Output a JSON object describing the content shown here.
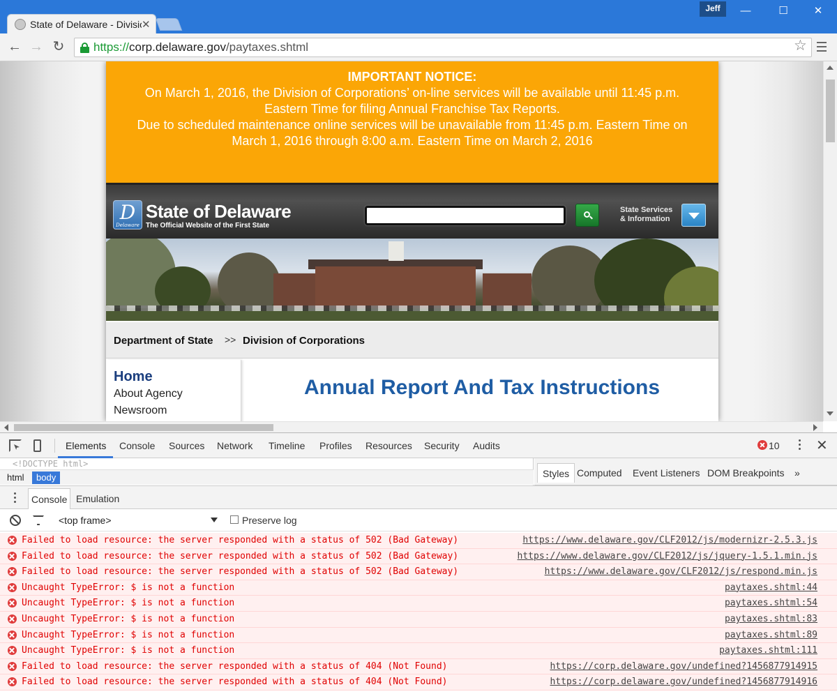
{
  "browser": {
    "tab_title": "State of Delaware - Divisio",
    "user": "Jeff",
    "url_scheme": "https://",
    "url_host": "corp.delaware.gov",
    "url_path": "/paytaxes.shtml",
    "minimize": "—",
    "maximize": "☐",
    "close": "✕"
  },
  "page": {
    "notice": {
      "title": "IMPORTANT NOTICE:",
      "line1": "On March 1, 2016, the Division of Corporations’ on-line services will be available until 11:45 p.m.",
      "line2": "Eastern Time for filing Annual Franchise Tax Reports.",
      "line3": "Due to scheduled maintenance online services will be unavailable from 11:45 p.m. Eastern Time on",
      "line4": "March 1, 2016 through 8:00 a.m. Eastern Time on March 2, 2016"
    },
    "header": {
      "seal_letter": "D",
      "seal_text": "Delaware",
      "title": "State of Delaware",
      "subtitle": "The Official Website of the First State",
      "services_line1": "State Services",
      "services_line2": "& Information"
    },
    "breadcrumb": {
      "first": "Department of State",
      "separator": ">>",
      "second": "Division of Corporations"
    },
    "sidenav": {
      "home": "Home",
      "about": "About Agency",
      "newsroom": "Newsroom"
    },
    "content_title": "Annual Report And Tax Instructions"
  },
  "devtools": {
    "tabs": [
      "Elements",
      "Console",
      "Sources",
      "Network",
      "Timeline",
      "Profiles",
      "Resources",
      "Security",
      "Audits"
    ],
    "error_count": "10",
    "doctype": "<!DOCTYPE html>",
    "dom_crumbs": [
      "html",
      "body"
    ],
    "sidebar_tabs": [
      "Styles",
      "Computed",
      "Event Listeners",
      "DOM Breakpoints",
      "»"
    ],
    "drawer_tabs": [
      "Console",
      "Emulation"
    ],
    "frame": "<top frame>",
    "preserve_log": "Preserve log",
    "messages": [
      {
        "text": "Failed to load resource: the server responded with a status of 502 (Bad Gateway)",
        "source": "https://www.delaware.gov/CLF2012/js/modernizr-2.5.3.js"
      },
      {
        "text": "Failed to load resource: the server responded with a status of 502 (Bad Gateway)",
        "source": "https://www.delaware.gov/CLF2012/js/jquery-1.5.1.min.js"
      },
      {
        "text": "Failed to load resource: the server responded with a status of 502 (Bad Gateway)",
        "source": "https://www.delaware.gov/CLF2012/js/respond.min.js"
      },
      {
        "text": "Uncaught TypeError: $ is not a function",
        "source": "paytaxes.shtml:44"
      },
      {
        "text": "Uncaught TypeError: $ is not a function",
        "source": "paytaxes.shtml:54"
      },
      {
        "text": "Uncaught TypeError: $ is not a function",
        "source": "paytaxes.shtml:83"
      },
      {
        "text": "Uncaught TypeError: $ is not a function",
        "source": "paytaxes.shtml:89"
      },
      {
        "text": "Uncaught TypeError: $ is not a function",
        "source": "paytaxes.shtml:111"
      },
      {
        "text": "Failed to load resource: the server responded with a status of 404 (Not Found)",
        "source": "https://corp.delaware.gov/undefined?1456877914915"
      },
      {
        "text": "Failed to load resource: the server responded with a status of 404 (Not Found)",
        "source": "https://corp.delaware.gov/undefined?1456877914916"
      }
    ]
  },
  "colors": {
    "notice_bg": "#fba606",
    "chrome_blue": "#2b78d9",
    "title_blue": "#1f5da4",
    "error_red": "#e00000",
    "secure_green": "#1a9a34"
  }
}
